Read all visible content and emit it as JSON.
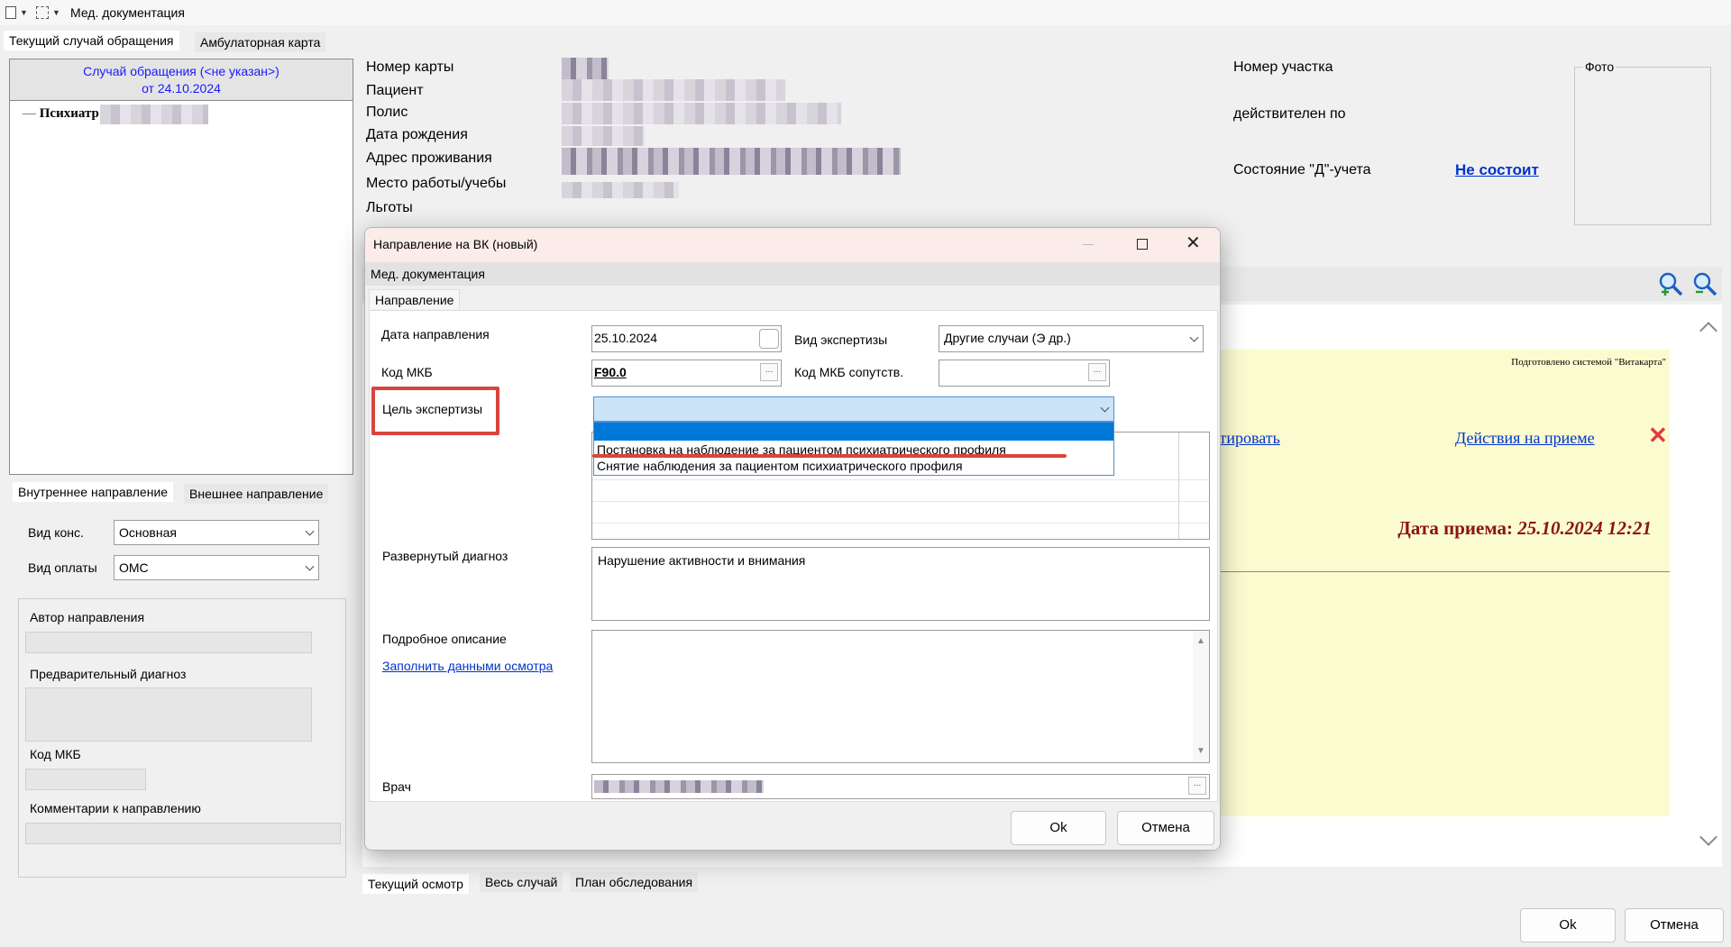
{
  "window": {
    "title": "Мед. документация"
  },
  "top_tabs": [
    "Текущий случай обращения",
    "Амбулаторная карта"
  ],
  "left_panel": {
    "case_title": "Случай обращения (<не указан>)",
    "case_date": "от 24.10.2024",
    "tree_item": "Психиатр",
    "direction_tabs": [
      "Внутреннее направление",
      "Внешнее направление"
    ],
    "vid_kons_label": "Вид конс.",
    "vid_kons_value": "Основная",
    "vid_oplaty_label": "Вид оплаты",
    "vid_oplaty_value": "ОМС",
    "author_label": "Автор направления",
    "prelim_diag_label": "Предварительный диагноз",
    "mkb_label": "Код МКБ",
    "comments_label": "Комментарии к направлению"
  },
  "patient": {
    "labels": [
      "Номер карты",
      "Пациент",
      "Полис",
      "Дата рождения",
      "Адрес проживания",
      "Место работы/учебы",
      "Льготы"
    ],
    "uchastok_label": "Номер участка",
    "valid_label": "действителен по",
    "d_status_label": "Состояние \"Д\"-учета",
    "d_status_value": "Не состоит",
    "photo_label": "Фото"
  },
  "document": {
    "prepared_by": "Подготовлено системой \"Витакарта\"",
    "link_edit": "ктировать",
    "link_actions": "Действия на приеме",
    "visit_date_label": "Дата приема:",
    "visit_date_value": "25.10.2024 12:21"
  },
  "bottom_tabs": [
    "Текущий осмотр",
    "Весь случай",
    "План обследования"
  ],
  "main_buttons": {
    "ok": "Ok",
    "cancel": "Отмена"
  },
  "dialog": {
    "title": "Направление на ВК (новый)",
    "menu": "Мед. документация",
    "tab": "Направление",
    "date_label": "Дата направления",
    "date_value": "25.10.2024",
    "expertise_label": "Вид экспертизы",
    "expertise_value": "Другие случаи (Э др.)",
    "mkb_label": "Код МКБ",
    "mkb_value": "F90.0",
    "mkb_sop_label": "Код МКБ сопутств.",
    "goal_label": "Цель экспертизы",
    "goal_value": "",
    "goal_options": [
      "Постановка на наблюдение за пациентом психиатрического профиля",
      "Снятие наблюдения за пациентом психиатрического профиля"
    ],
    "diag_label": "Развернутый диагноз",
    "diag_value": "Нарушение активности и внимания",
    "desc_label": "Подробное описание",
    "fill_link": "Заполнить данными осмотра",
    "doctor_label": "Врач",
    "ok": "Ok",
    "cancel": "Отмена"
  },
  "colors": {
    "highlight_red": "#d9453c",
    "link_blue": "#0033cc",
    "doc_yellow": "#fbfbd0",
    "dropdown_selected": "#0078d7",
    "combo_focus": "#cce4f7"
  }
}
